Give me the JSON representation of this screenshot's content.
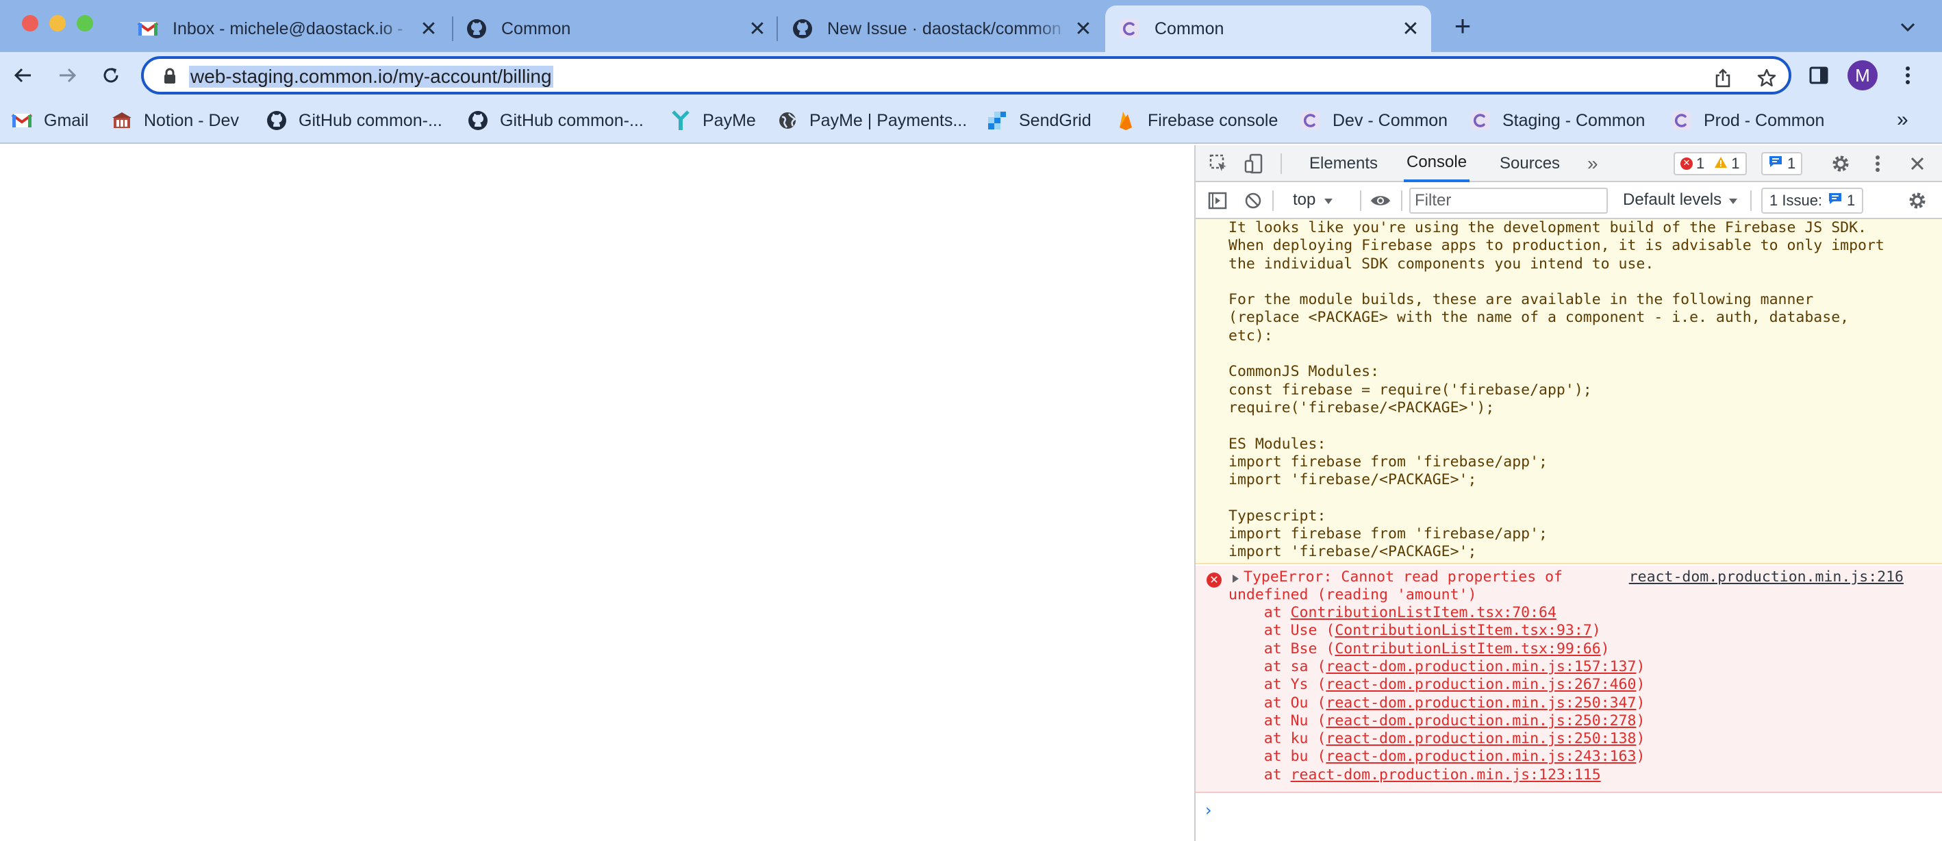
{
  "browser": {
    "tabs": [
      {
        "title": "Inbox - michele@daostack.io -",
        "favicon": "gmail-icon",
        "active": false
      },
      {
        "title": "Common",
        "favicon": "github-icon",
        "active": false
      },
      {
        "title": "New Issue · daostack/common",
        "favicon": "github-icon",
        "active": false
      },
      {
        "title": "Common",
        "favicon": "common-c-icon",
        "active": true
      }
    ],
    "new_tab_label": "+",
    "close_label": "✕",
    "url": "web-staging.common.io/my-account/billing",
    "avatar_initial": "M",
    "accent_color": "#1a57c9"
  },
  "bookmarks": {
    "items": [
      {
        "label": "Gmail",
        "icon": "gmail-icon"
      },
      {
        "label": "Notion - Dev",
        "icon": "notion-icon"
      },
      {
        "label": "GitHub common-...",
        "icon": "github-icon"
      },
      {
        "label": "GitHub common-...",
        "icon": "github-icon"
      },
      {
        "label": "PayMe",
        "icon": "payme-icon"
      },
      {
        "label": "PayMe | Payments...",
        "icon": "globe-icon"
      },
      {
        "label": "SendGrid",
        "icon": "sendgrid-icon"
      },
      {
        "label": "Firebase console",
        "icon": "firebase-icon"
      },
      {
        "label": "Dev - Common",
        "icon": "common-c-icon"
      },
      {
        "label": "Staging - Common",
        "icon": "common-c-icon"
      },
      {
        "label": "Prod - Common",
        "icon": "common-c-icon"
      }
    ],
    "more_label": "»"
  },
  "devtools": {
    "tabs": [
      {
        "label": "Elements",
        "active": false
      },
      {
        "label": "Console",
        "active": true
      },
      {
        "label": "Sources",
        "active": false
      }
    ],
    "more_tabs_label": "»",
    "error_count": "1",
    "warning_count": "1",
    "message_count": "1",
    "context": "top",
    "filter_placeholder": "Filter",
    "levels_label": "Default levels",
    "issues_label": "1 Issue:",
    "issues_count": "1",
    "warning_text": "It looks like you're using the development build of the Firebase JS SDK.\nWhen deploying Firebase apps to production, it is advisable to only import\nthe individual SDK components you intend to use.\n\nFor the module builds, these are available in the following manner\n(replace <PACKAGE> with the name of a component - i.e. auth, database,\netc):\n\nCommonJS Modules:\nconst firebase = require('firebase/app');\nrequire('firebase/<PACKAGE>');\n\nES Modules:\nimport firebase from 'firebase/app';\nimport 'firebase/<PACKAGE>';\n\nTypescript:\nimport firebase from 'firebase/app';\nimport 'firebase/<PACKAGE>';",
    "error": {
      "line1": "TypeError: Cannot read properties of",
      "line2": "undefined (reading 'amount')",
      "source": "react-dom.production.min.js:216",
      "stack": [
        {
          "prefix": "    at ",
          "fn": "",
          "loc": "ContributionListItem.tsx:70:64"
        },
        {
          "prefix": "    at ",
          "fn": "Use",
          "loc": "ContributionListItem.tsx:93:7"
        },
        {
          "prefix": "    at ",
          "fn": "Bse",
          "loc": "ContributionListItem.tsx:99:66"
        },
        {
          "prefix": "    at ",
          "fn": "sa",
          "loc": "react-dom.production.min.js:157:137"
        },
        {
          "prefix": "    at ",
          "fn": "Ys",
          "loc": "react-dom.production.min.js:267:460"
        },
        {
          "prefix": "    at ",
          "fn": "Ou",
          "loc": "react-dom.production.min.js:250:347"
        },
        {
          "prefix": "    at ",
          "fn": "Nu",
          "loc": "react-dom.production.min.js:250:278"
        },
        {
          "prefix": "    at ",
          "fn": "ku",
          "loc": "react-dom.production.min.js:250:138"
        },
        {
          "prefix": "    at ",
          "fn": "bu",
          "loc": "react-dom.production.min.js:243:163"
        },
        {
          "prefix": "    at ",
          "fn": "",
          "loc": "react-dom.production.min.js:123:115"
        }
      ]
    },
    "prompt_symbol": "›"
  }
}
